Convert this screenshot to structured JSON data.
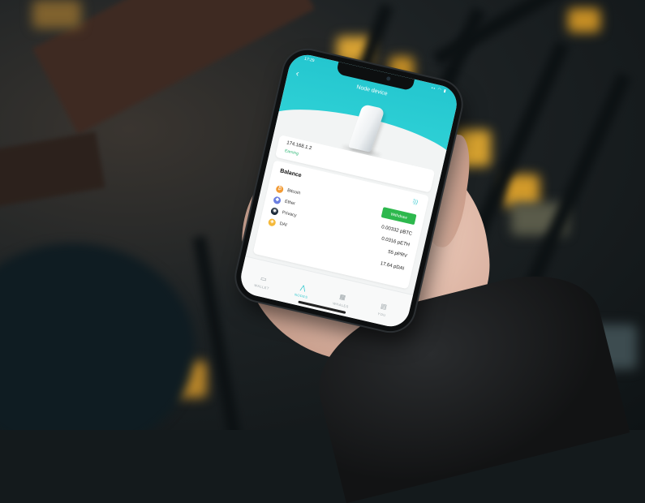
{
  "status": {
    "time": "17:29",
    "icons": "▪▪ ◠ ▮"
  },
  "header": {
    "back_glyph": "‹",
    "title": "Node device"
  },
  "node": {
    "ip": "174.168.1.2",
    "status": "Earning"
  },
  "balance": {
    "title": "Balance",
    "withdraw_label": "Withdraw",
    "coins": [
      {
        "name": "Bitcoin",
        "icon": "bitcoin-icon",
        "color": "#f29a33",
        "amount": "0.00332 pBTC"
      },
      {
        "name": "Ether",
        "icon": "ether-icon",
        "color": "#6b7fe0",
        "amount": "0.0316 pETH"
      },
      {
        "name": "Privacy",
        "icon": "privacy-icon",
        "color": "#1d2b3a",
        "amount": "55 pPRV"
      },
      {
        "name": "DAI",
        "icon": "dai-icon",
        "color": "#f5b93a",
        "amount": "17.64 pDAI"
      }
    ]
  },
  "nav": [
    {
      "label": "WALLET",
      "icon": "wallet-icon",
      "active": false
    },
    {
      "label": "NODES",
      "icon": "nodes-icon",
      "active": true
    },
    {
      "label": "WHALES",
      "icon": "whales-icon",
      "active": false
    },
    {
      "label": "YOU",
      "icon": "you-icon",
      "active": false
    }
  ],
  "colors": {
    "accent": "#26c5cc",
    "withdraw": "#2db84d",
    "earning": "#2bb673"
  }
}
